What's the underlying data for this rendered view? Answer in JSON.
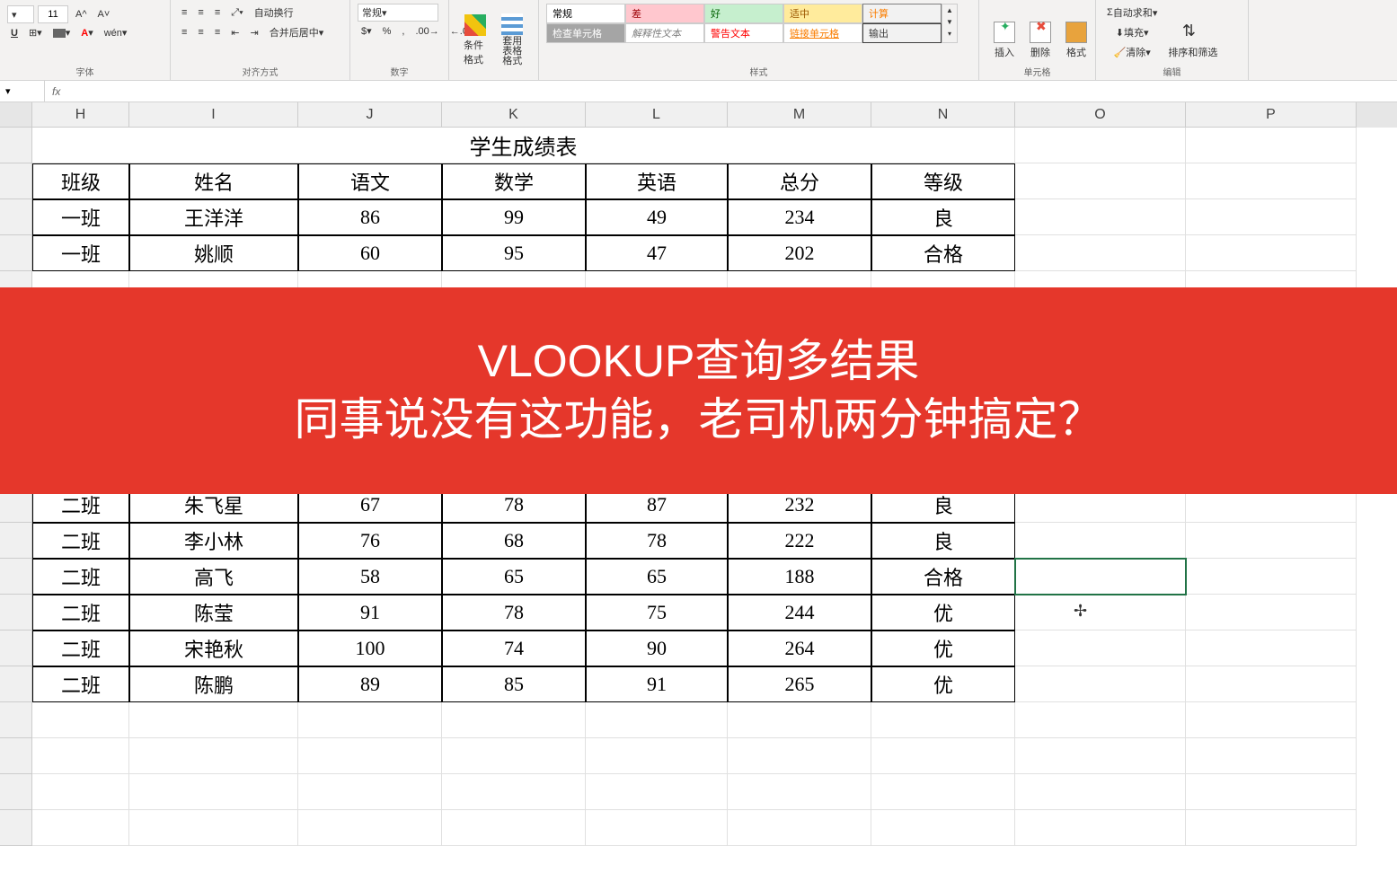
{
  "ribbon": {
    "font_size": "11",
    "wrap_text": "自动换行",
    "merge_center": "合并后居中",
    "number_format": "常规",
    "cond_format": "条件格式",
    "format_table": "套用\n表格格式",
    "group_font": "字体",
    "group_align": "对齐方式",
    "group_number": "数字",
    "group_styles": "样式",
    "group_cells": "单元格",
    "group_edit": "编辑",
    "insert": "插入",
    "delete": "删除",
    "format": "格式",
    "autosum": "自动求和",
    "fill": "填充",
    "clear": "清除",
    "sort_filter": "排序和筛选",
    "styles": {
      "normal": "常规",
      "bad": "差",
      "good": "好",
      "neutral": "适中",
      "calc": "计算",
      "check": "检查单元格",
      "explain": "解释性文本",
      "warn": "警告文本",
      "link": "链接单元格",
      "output": "输出"
    }
  },
  "formula_bar": {
    "fx": "fx",
    "value": ""
  },
  "columns": [
    "H",
    "I",
    "J",
    "K",
    "L",
    "M",
    "N",
    "O",
    "P"
  ],
  "title": "学生成绩表",
  "headers": [
    "班级",
    "姓名",
    "语文",
    "数学",
    "英语",
    "总分",
    "等级"
  ],
  "rows": [
    [
      "一班",
      "王洋洋",
      "86",
      "99",
      "49",
      "234",
      "良"
    ],
    [
      "一班",
      "姚顺",
      "60",
      "95",
      "47",
      "202",
      "合格"
    ],
    [
      "二班",
      "朱飞星",
      "67",
      "78",
      "87",
      "232",
      "良"
    ],
    [
      "二班",
      "李小林",
      "76",
      "68",
      "78",
      "222",
      "良"
    ],
    [
      "二班",
      "高飞",
      "58",
      "65",
      "65",
      "188",
      "合格"
    ],
    [
      "二班",
      "陈莹",
      "91",
      "78",
      "75",
      "244",
      "优"
    ],
    [
      "二班",
      "宋艳秋",
      "100",
      "74",
      "90",
      "264",
      "优"
    ],
    [
      "二班",
      "陈鹏",
      "89",
      "85",
      "91",
      "265",
      "优"
    ]
  ],
  "banner": {
    "line1": "VLOOKUP查询多结果",
    "line2": "同事说没有这功能，老司机两分钟搞定？"
  },
  "cursor": "✢"
}
